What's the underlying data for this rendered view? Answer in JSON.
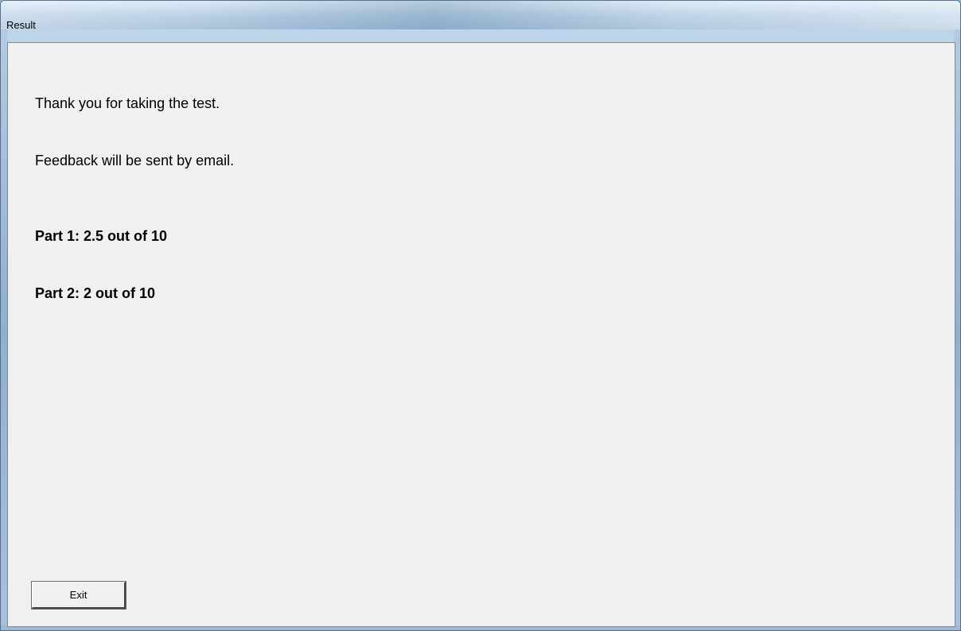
{
  "window": {
    "title": "Result"
  },
  "content": {
    "thank_you": "Thank you for taking the test.",
    "feedback": "Feedback will be sent by email.",
    "scores": [
      {
        "label": "Part 1: 2.5 out of 10"
      },
      {
        "label": "Part 2: 2 out of 10"
      }
    ]
  },
  "buttons": {
    "exit_label": "Exit"
  },
  "colors": {
    "client_background": "#f0f0f0",
    "titlebar": "#b2cbe2"
  }
}
